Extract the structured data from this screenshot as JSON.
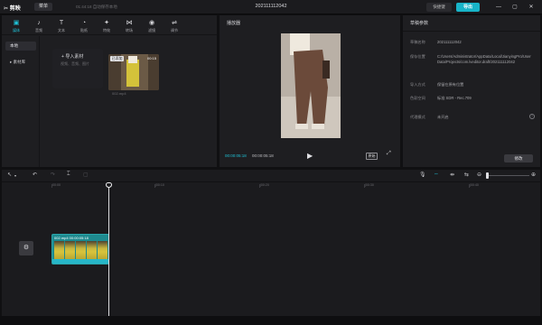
{
  "app": {
    "logo": "✂ 剪映",
    "menu_label": "菜单",
    "autosave": "01:44:18 自动保存本地",
    "window_title": "202111112042",
    "shortcut_label": "快捷键",
    "export_label": "导出"
  },
  "window_controls": {
    "minimize": "—",
    "maximize": "▢",
    "close": "✕"
  },
  "tool_tabs": [
    {
      "label": "媒体",
      "icon": "▣"
    },
    {
      "label": "音频",
      "icon": "♪"
    },
    {
      "label": "文本",
      "icon": "T"
    },
    {
      "label": "贴纸",
      "icon": "◔"
    },
    {
      "label": "特效",
      "icon": "✦"
    },
    {
      "label": "转场",
      "icon": "⋈"
    },
    {
      "label": "滤镜",
      "icon": "◉"
    },
    {
      "label": "调节",
      "icon": "⇌"
    }
  ],
  "media_nav": [
    {
      "label": "本地"
    },
    {
      "label": "▸ 素材库"
    }
  ],
  "import": {
    "label": "导入素材",
    "sub": "视频、音频、图片"
  },
  "media_item": {
    "badge": "已添加",
    "duration": "00:15",
    "name": "002.mp4"
  },
  "player": {
    "title": "播放器",
    "current_time": "00:00:05:18",
    "total_time": "00:00:05:18",
    "ratio_label": "原始",
    "play_icon": "▶",
    "fullscreen_icon": "⤢"
  },
  "props": {
    "title": "草稿参数",
    "rows": [
      {
        "key": "草稿名称",
        "value": "202111112042"
      },
      {
        "key": "保存位置",
        "value": "C:/Users/Administrator/AppData/Local/JianyingPro/User Data/Projects/com.lveditor.draft/202111112042"
      },
      {
        "key": "导入方式",
        "value": "保留在原有位置"
      },
      {
        "key": "色彩空间",
        "value": "标准 SDR - Rec.709"
      },
      {
        "key": "代理模式",
        "value": "未开启"
      }
    ],
    "modify_label": "修改"
  },
  "timeline": {
    "ticks": [
      "00:00",
      "|00:10",
      "|00:20",
      "|00:30",
      "|00:40"
    ],
    "clip_label": "002.mp4   00:00:05:18",
    "cover_icon": "⚙"
  }
}
